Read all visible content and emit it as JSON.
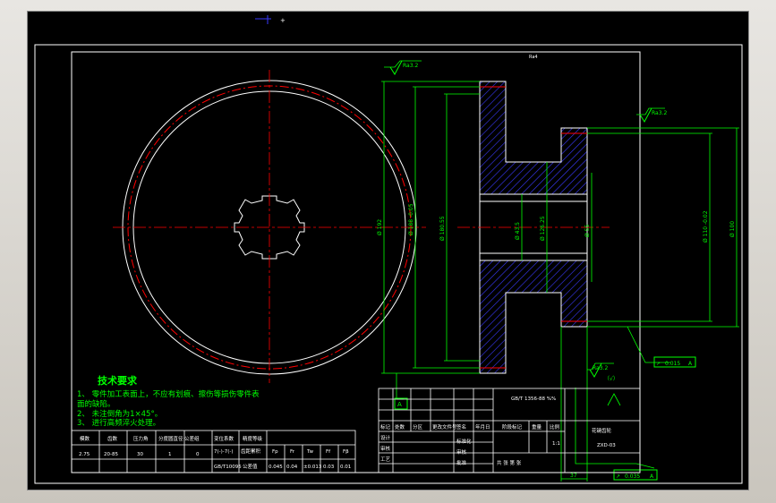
{
  "colors": {
    "canvas": "#000000",
    "frame_line": "#ffffff",
    "dimension": "#00ff00",
    "center_line": "#ff0000",
    "hatch": "#3a3aff",
    "title_block": "#ffffff"
  },
  "drawing": {
    "origin_marker": "+",
    "tech_req_title": "技术要求",
    "tech_req_lines": [
      "1、 零件加工表面上，不应有划痕、擦伤等损伤零件表",
      "    面的缺陷。",
      "2、 未注倒角为1×45°。",
      "3、 进行高频淬火处理。"
    ],
    "roughness_top": "Ra3.2",
    "roughness_right": "Ra3.2",
    "roughness_bottom": "Ra3.2",
    "roughness_bottom_note": "（√）",
    "tol_runout": "0.015",
    "tol_parallel": "0.035",
    "datum_a": "A",
    "dims_v1": "Ø 192",
    "dims_v2": "Ø 188 -0.05",
    "dims_v3": "Ø 180.55",
    "dims_v4": "Ø 43.5",
    "dims_v5": "Ø 126.25",
    "dims_v6": "Ø 55",
    "dims_v7": "Ø 110 -0.02",
    "dims_v8": "Ø 100",
    "dim_bottom": "37",
    "small_top_label": "Ra4"
  },
  "param_table": {
    "headers": [
      "模数",
      "齿数",
      "压力角",
      "分度圆直径",
      "变位系数",
      "精度等级",
      "公差组",
      "",
      "",
      "",
      "",
      ""
    ],
    "row1": [
      "2.75",
      "20-85",
      "30",
      "1",
      "0",
      "7(-)-7(-)",
      "齿距累积",
      "Fp",
      "Fr",
      "Tw",
      "Ff",
      "Fβ"
    ],
    "row2": [
      "",
      "",
      "",
      "",
      "",
      "GB/T10095",
      "公差值",
      "0.045",
      "0.04",
      "±0.013",
      "0.03",
      "0.01"
    ]
  },
  "title_block": {
    "standard": "GB/T 1356-88  %%",
    "labels": [
      "标记",
      "处数",
      "分区",
      "更改文件号",
      "签名",
      "年月日"
    ],
    "design": "设计",
    "check": "审核",
    "process": "工艺",
    "standardize": "标准化",
    "approve": "批准",
    "stage": "阶段标记",
    "weight": "重量",
    "scale": "比例",
    "scale_val": "1:1",
    "part_name": "花键齿轮",
    "sheet": "共 张 第 张",
    "code": "ZXD-03"
  }
}
